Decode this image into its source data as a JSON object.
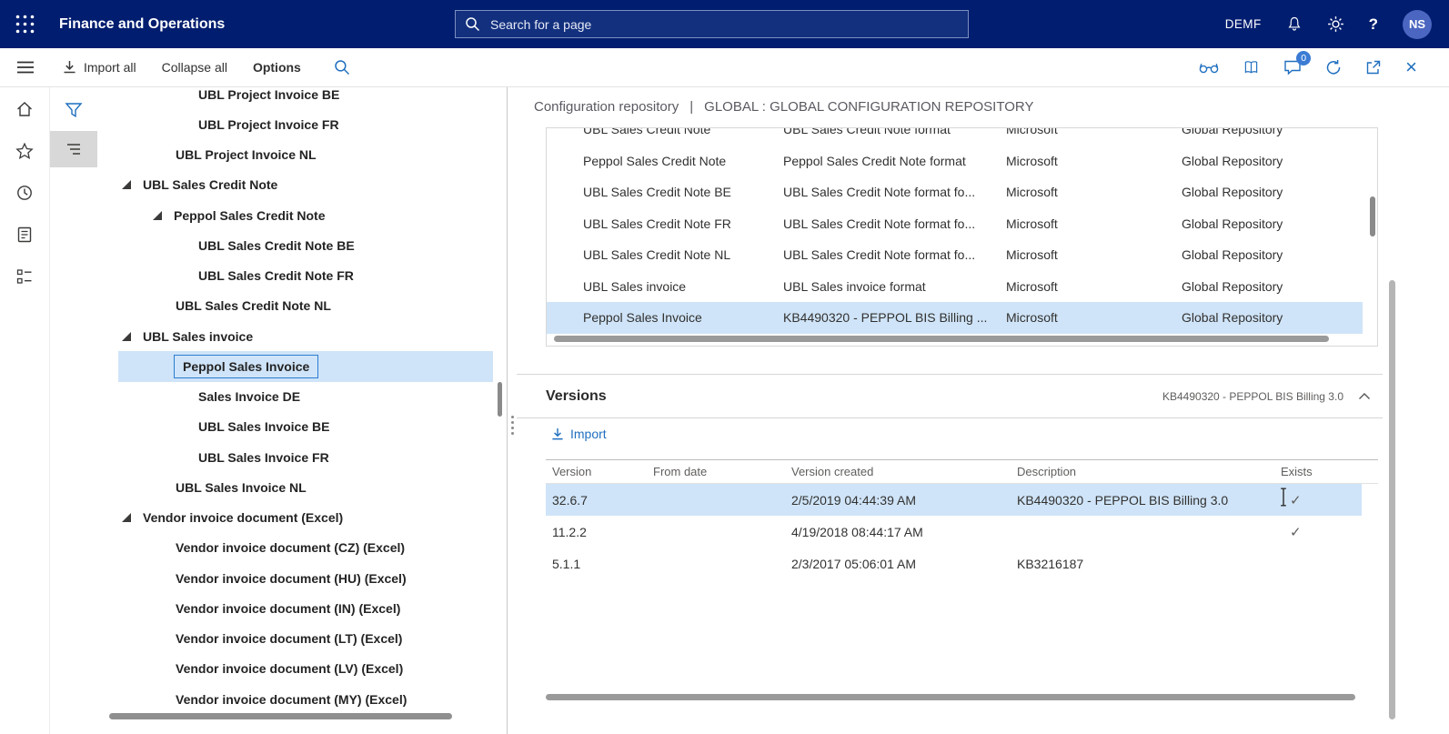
{
  "colors": {
    "brand-bar": "#001d6f",
    "accent": "#1f6fbf",
    "selection": "#cfe4f8",
    "selection-border": "#2b7cd3",
    "badge": "#3b7bd4"
  },
  "icons": {
    "close": "×",
    "check": "✓",
    "help": "?"
  },
  "topbar": {
    "title": "Finance and Operations",
    "search_placeholder": "Search for a page",
    "company": "DEMF",
    "avatar_initials": "NS"
  },
  "toolbar": {
    "import_all": "Import all",
    "collapse_all": "Collapse all",
    "options": "Options",
    "message_count": "0"
  },
  "content_header": {
    "page": "Configuration repository",
    "separator": "|",
    "context": "GLOBAL : GLOBAL CONFIGURATION REPOSITORY"
  },
  "tree": {
    "items": [
      {
        "label": "UBL Project Invoice BE",
        "level": 2
      },
      {
        "label": "UBL Project Invoice FR",
        "level": 2
      },
      {
        "label": "UBL Project Invoice NL",
        "level": 1
      },
      {
        "label": "UBL Sales Credit Note",
        "level": 0,
        "expanded": true
      },
      {
        "label": "Peppol Sales Credit Note",
        "level": 1,
        "expanded": true
      },
      {
        "label": "UBL Sales Credit Note BE",
        "level": 2
      },
      {
        "label": "UBL Sales Credit Note FR",
        "level": 2
      },
      {
        "label": "UBL Sales Credit Note NL",
        "level": 1
      },
      {
        "label": "UBL Sales invoice",
        "level": 0,
        "expanded": true
      },
      {
        "label": "Peppol Sales Invoice",
        "level": 1,
        "expanded": true,
        "selected": true
      },
      {
        "label": "Sales Invoice DE",
        "level": 2
      },
      {
        "label": "UBL Sales Invoice BE",
        "level": 2
      },
      {
        "label": "UBL Sales Invoice FR",
        "level": 2
      },
      {
        "label": "UBL Sales Invoice NL",
        "level": 1
      },
      {
        "label": "Vendor invoice document (Excel)",
        "level": 0,
        "expanded": true
      },
      {
        "label": "Vendor invoice document (CZ) (Excel)",
        "level": 1
      },
      {
        "label": "Vendor invoice document (HU) (Excel)",
        "level": 1
      },
      {
        "label": "Vendor invoice document (IN) (Excel)",
        "level": 1
      },
      {
        "label": "Vendor invoice document (LT) (Excel)",
        "level": 1
      },
      {
        "label": "Vendor invoice document (LV) (Excel)",
        "level": 1
      },
      {
        "label": "Vendor invoice document (MY) (Excel)",
        "level": 1
      }
    ]
  },
  "repository_grid": {
    "rows": [
      {
        "name": "UBL Sales Credit Note",
        "description": "UBL Sales Credit Note format",
        "provider": "Microsoft",
        "repository": "Global Repository"
      },
      {
        "name": "Peppol Sales Credit Note",
        "description": "Peppol Sales Credit Note format",
        "provider": "Microsoft",
        "repository": "Global Repository"
      },
      {
        "name": "UBL Sales Credit Note BE",
        "description": "UBL Sales Credit Note format fo...",
        "provider": "Microsoft",
        "repository": "Global Repository"
      },
      {
        "name": "UBL Sales Credit Note FR",
        "description": "UBL Sales Credit Note format fo...",
        "provider": "Microsoft",
        "repository": "Global Repository"
      },
      {
        "name": "UBL Sales Credit Note NL",
        "description": "UBL Sales Credit Note format fo...",
        "provider": "Microsoft",
        "repository": "Global Repository"
      },
      {
        "name": "UBL Sales invoice",
        "description": "UBL Sales invoice format",
        "provider": "Microsoft",
        "repository": "Global Repository"
      },
      {
        "name": "Peppol Sales Invoice",
        "description": "KB4490320 - PEPPOL BIS Billing ...",
        "provider": "Microsoft",
        "repository": "Global Repository",
        "selected": true
      }
    ]
  },
  "versions": {
    "title": "Versions",
    "subtitle": "KB4490320 - PEPPOL BIS Billing 3.0",
    "import_label": "Import",
    "columns": [
      "Version",
      "From date",
      "Version created",
      "Description",
      "Exists"
    ],
    "rows": [
      {
        "version": "32.6.7",
        "from_date": "",
        "created": "2/5/2019 04:44:39 AM",
        "description": "KB4490320 - PEPPOL BIS Billing 3.0",
        "exists": true,
        "selected": true
      },
      {
        "version": "11.2.2",
        "from_date": "",
        "created": "4/19/2018 08:44:17 AM",
        "description": "",
        "exists": true,
        "selected": false
      },
      {
        "version": "5.1.1",
        "from_date": "",
        "created": "2/3/2017 05:06:01 AM",
        "description": "KB3216187",
        "exists": false,
        "selected": false
      }
    ]
  }
}
